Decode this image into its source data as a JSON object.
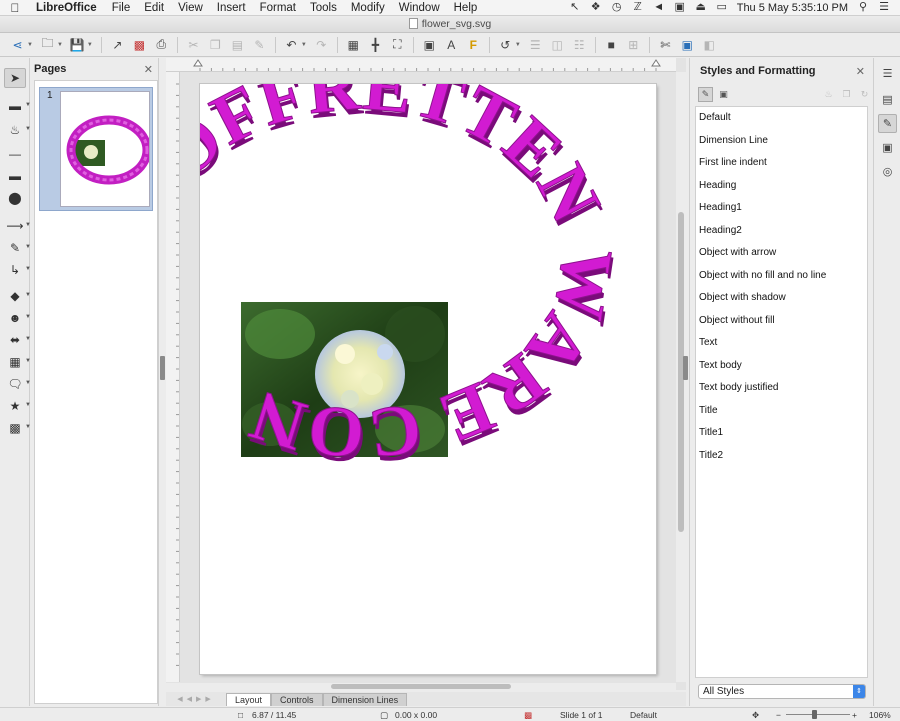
{
  "menubar": {
    "app": "LibreOffice",
    "items": [
      "File",
      "Edit",
      "View",
      "Insert",
      "Format",
      "Tools",
      "Modify",
      "Window",
      "Help"
    ],
    "clock": "Thu 5 May  5:35:10 PM"
  },
  "window": {
    "title": "flower_svg.svg"
  },
  "pages_panel": {
    "title": "Pages",
    "page_number": "1"
  },
  "sidebar": {
    "title": "Styles and Formatting",
    "styles": [
      "Default",
      "Dimension Line",
      "First line indent",
      "Heading",
      "Heading1",
      "Heading2",
      "Object with arrow",
      "Object with no fill and no line",
      "Object with shadow",
      "Object without fill",
      "Text",
      "Text body",
      "Text body justified",
      "Title",
      "Title1",
      "Title2"
    ],
    "filter": "All Styles"
  },
  "canvas": {
    "arc_text": "STOFFRETTEN WARE CONTI"
  },
  "layer_tabs": [
    "Layout",
    "Controls",
    "Dimension Lines"
  ],
  "status": {
    "position": "6.87 / 11.45",
    "size": "0.00 x 0.00",
    "slide": "Slide 1 of 1",
    "master": "Default",
    "zoom": "106%"
  },
  "colors": {
    "text_art": "#cc1fcc",
    "accent": "#3c86e8",
    "selection": "#b9cbe4"
  }
}
